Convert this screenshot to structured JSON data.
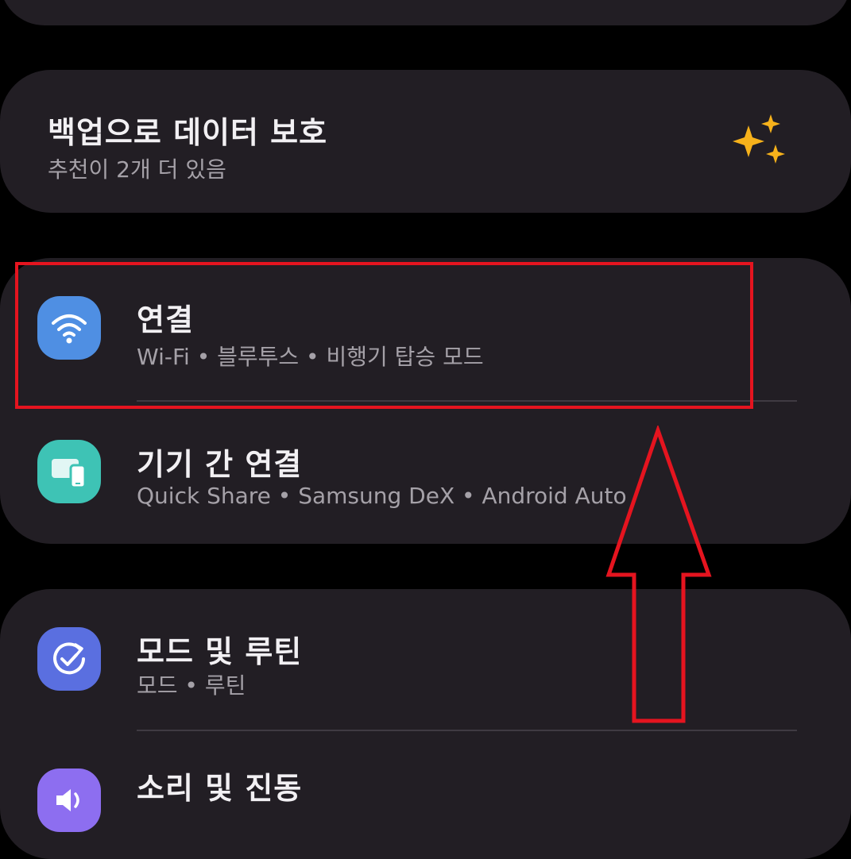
{
  "backup": {
    "title": "백업으로 데이터 보호",
    "subtitle": "추천이 2개 더 있음",
    "icon": "sparkle-icon",
    "accent": "#f7b21b"
  },
  "settings": [
    {
      "title": "연결",
      "subtitle": "Wi-Fi • 블루투스 • 비행기 탑승 모드",
      "icon": "wifi-icon",
      "color": "#4f8fe3"
    },
    {
      "title": "기기 간 연결",
      "subtitle": "Quick Share • Samsung DeX • Android Auto",
      "icon": "devices-icon",
      "color": "#3ec3b5"
    },
    {
      "title": "모드 및 루틴",
      "subtitle": "모드 • 루틴",
      "icon": "check-circle-icon",
      "color": "#5a6fe0"
    },
    {
      "title": "소리 및 진동",
      "icon": "sound-icon",
      "color": "#8d6ef0"
    }
  ],
  "annotation": {
    "highlight_color": "#e5141f"
  }
}
